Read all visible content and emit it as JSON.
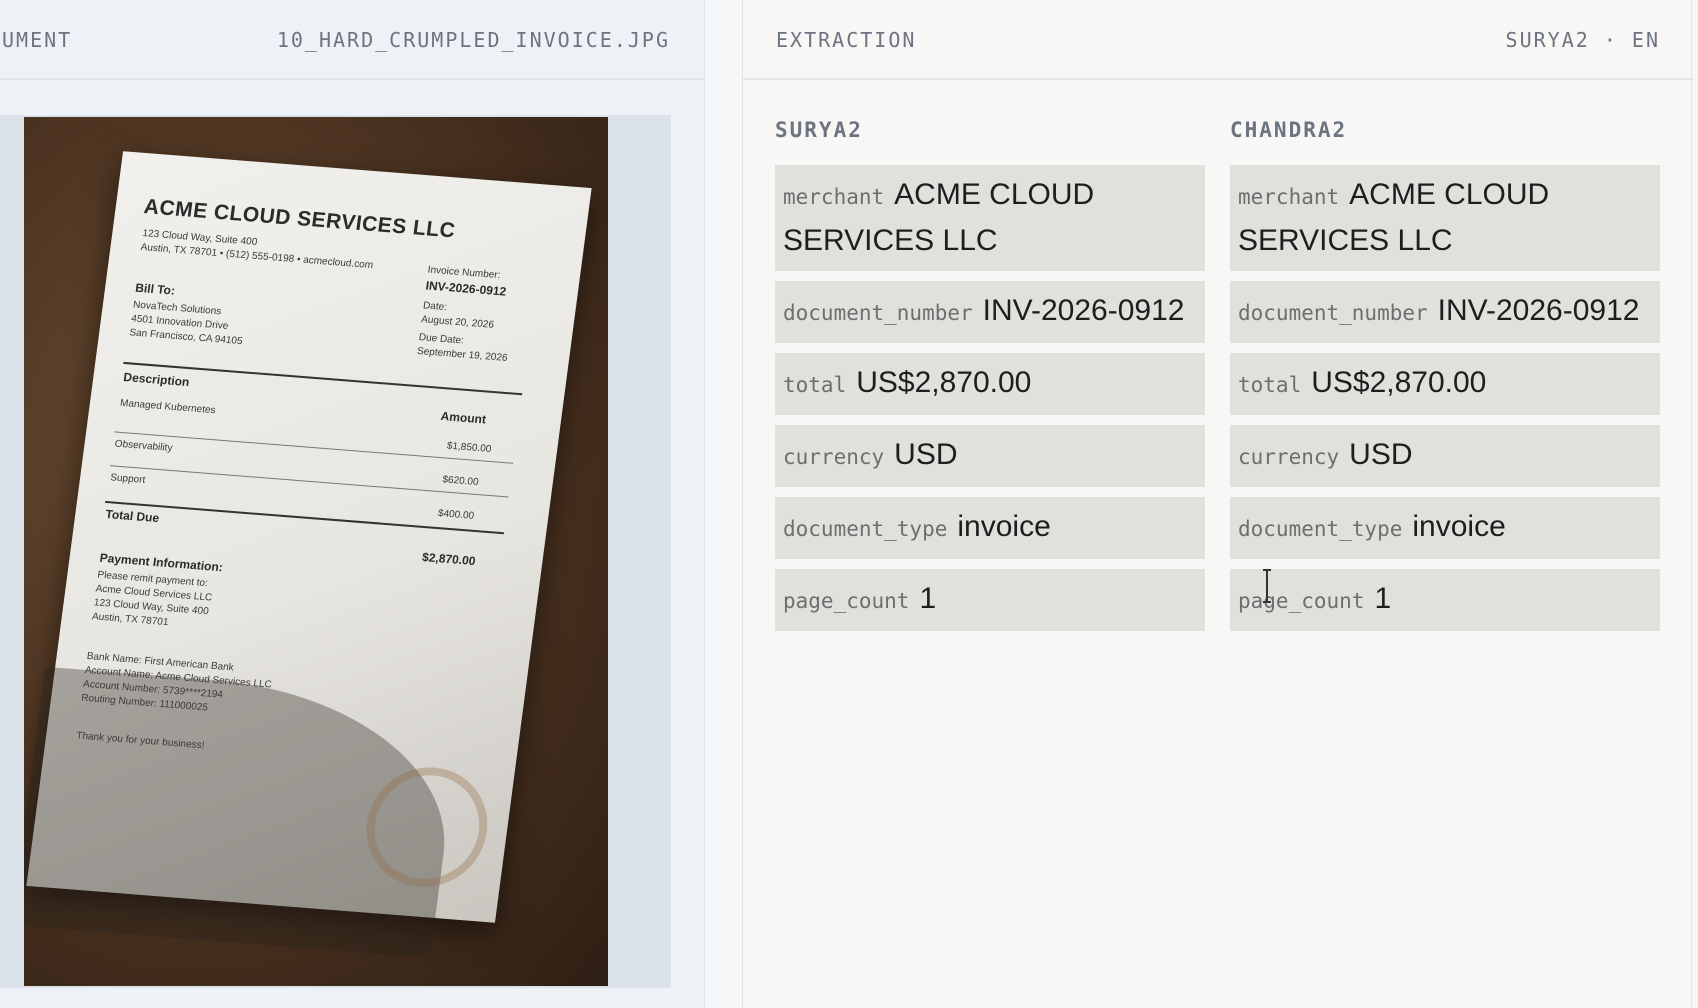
{
  "left_header": {
    "section_label": "UMENT",
    "filename": "10_HARD_CRUMPLED_INVOICE.JPG"
  },
  "invoice": {
    "company": "ACME CLOUD SERVICES LLC",
    "address1": "123 Cloud Way, Suite 400",
    "address2": "Austin, TX 78701 • (512) 555-0198 • acmecloud.com",
    "invoice_number_label": "Invoice Number:",
    "invoice_number": "INV-2026-0912",
    "date_label": "Date:",
    "date": "August 20, 2026",
    "due_label": "Due Date:",
    "due": "September 19, 2026",
    "bill_to_label": "Bill To:",
    "bill_to": [
      "NovaTech Solutions",
      "4501 Innovation Drive",
      "San Francisco, CA 94105"
    ],
    "description_label": "Description",
    "amount_label": "Amount",
    "items": [
      {
        "desc": "Managed Kubernetes",
        "amount": "$1,850.00"
      },
      {
        "desc": "Observability",
        "amount": "$620.00"
      },
      {
        "desc": "Support",
        "amount": "$400.00"
      }
    ],
    "total_label": "Total Due",
    "total": "$2,870.00",
    "payment_label": "Payment Information:",
    "payment_lines": [
      "Please remit payment to:",
      "Acme Cloud Services LLC",
      "123 Cloud Way, Suite 400",
      "Austin, TX 78701"
    ],
    "bank_lines": [
      "Bank Name:  First American Bank",
      "Account Name:  Acme Cloud Services LLC",
      "Account Number:  5739****2194",
      "Routing Number:  111000025"
    ],
    "thanks": "Thank you for your business!"
  },
  "right_header": {
    "section_label": "EXTRACTION",
    "engine": "SURYA2 · EN"
  },
  "columns": [
    {
      "title": "SURYA2",
      "fields": [
        {
          "key": "merchant",
          "value": "ACME CLOUD SERVICES LLC"
        },
        {
          "key": "document_number",
          "value": "INV-2026-0912"
        },
        {
          "key": "total",
          "value": "US$2,870.00"
        },
        {
          "key": "currency",
          "value": "USD"
        },
        {
          "key": "document_type",
          "value": "invoice"
        },
        {
          "key": "page_count",
          "value": "1"
        }
      ]
    },
    {
      "title": "CHANDRA2",
      "fields": [
        {
          "key": "merchant",
          "value": "ACME CLOUD SERVICES LLC"
        },
        {
          "key": "document_number",
          "value": "INV-2026-0912"
        },
        {
          "key": "total",
          "value": "US$2,870.00"
        },
        {
          "key": "currency",
          "value": "USD"
        },
        {
          "key": "document_type",
          "value": "invoice"
        },
        {
          "key": "page_count",
          "value": "1"
        }
      ]
    }
  ]
}
